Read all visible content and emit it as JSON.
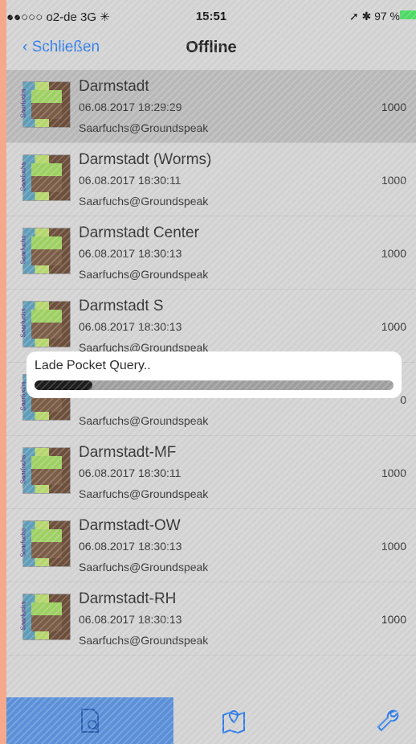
{
  "status_bar": {
    "carrier": "●●○○○ o2-de  3G  ✳",
    "time": "15:51",
    "right": "➚ ✱ 97 %",
    "battery_color": "#4cd964"
  },
  "nav": {
    "back_label": "Schließen",
    "title": "Offline"
  },
  "list": {
    "items": [
      {
        "name": "Darmstadt",
        "date": "06.08.2017 18:29:29",
        "owner": "Saarfuchs@Groundspeak",
        "count": "1000"
      },
      {
        "name": "Darmstadt (Worms)",
        "date": "06.08.2017 18:30:11",
        "owner": "Saarfuchs@Groundspeak",
        "count": "1000"
      },
      {
        "name": "Darmstadt Center",
        "date": "06.08.2017 18:30:13",
        "owner": "Saarfuchs@Groundspeak",
        "count": "1000"
      },
      {
        "name": "Darmstadt S",
        "date": "06.08.2017 18:30:13",
        "owner": "Saarfuchs@Groundspeak",
        "count": "1000"
      },
      {
        "name": "",
        "date": "",
        "owner": "Saarfuchs@Groundspeak",
        "count": "0"
      },
      {
        "name": "Darmstadt-MF",
        "date": "06.08.2017 18:30:11",
        "owner": "Saarfuchs@Groundspeak",
        "count": "1000"
      },
      {
        "name": "Darmstadt-OW",
        "date": "06.08.2017 18:30:13",
        "owner": "Saarfuchs@Groundspeak",
        "count": "1000"
      },
      {
        "name": "Darmstadt-RH",
        "date": "06.08.2017 18:30:13",
        "owner": "Saarfuchs@Groundspeak",
        "count": "1000"
      }
    ]
  },
  "popup": {
    "message": "Lade Pocket Query..",
    "progress": 0.16
  },
  "tabbar": {
    "tabs": [
      {
        "icon": "document-search-icon",
        "active": true
      },
      {
        "icon": "map-location-icon",
        "active": false
      },
      {
        "icon": "wrench-icon",
        "active": false
      }
    ],
    "accent": "#5b8fd8"
  }
}
